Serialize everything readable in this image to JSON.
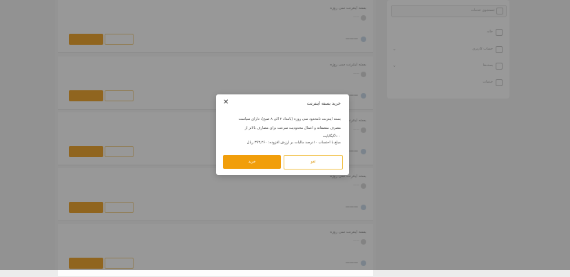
{
  "sidebar": {
    "search_label": "جستجوی خدمات",
    "items": [
      {
        "label": "خانه",
        "icon": "home-icon",
        "has_chevron": false
      },
      {
        "label": "حساب کاربری",
        "icon": "user-icon",
        "has_chevron": true
      },
      {
        "label": "بسته‌ها",
        "icon": "package-icon",
        "has_chevron": true
      },
      {
        "label": "خدمات",
        "icon": "services-icon",
        "has_chevron": false
      }
    ]
  },
  "modal": {
    "title": "خرید بسته اینترنت",
    "close_symbol": "✕",
    "description_lines": [
      "بسته اینترنت نامحدود سی روزه (بامداد ۲ الی ۸ صبح)، دارای سیاست",
      "مصرف منصفانه و اعمال محدودیت سرعت برای مصارف بالاتر از",
      "۱۰۰گیگابایت"
    ],
    "price_text": "مبلغ با احتساب ۱۰درصد مالیات بر ارزش افزوده: ۳۹۳,۲۶۰ ریال",
    "cancel_label": "لغو",
    "buy_label": "خرید"
  },
  "colors": {
    "accent": "#f19e0b",
    "accent_outline": "#f2c24a",
    "overlay": "rgba(0,0,0,0.40)"
  }
}
